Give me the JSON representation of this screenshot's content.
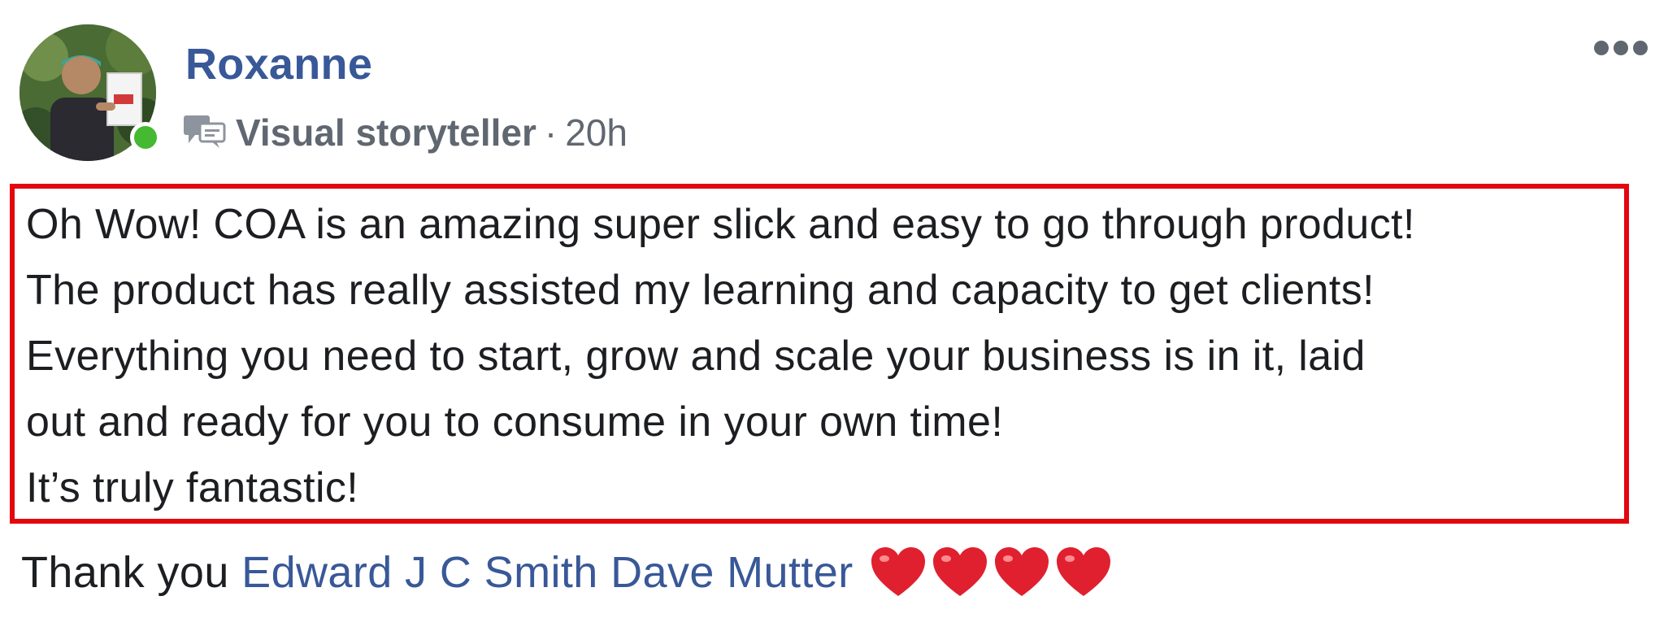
{
  "post": {
    "author": "Roxanne",
    "badge": "Visual storyteller",
    "separator": "·",
    "timestamp": "20h",
    "body_lines": [
      "Oh Wow! COA is an amazing super slick and easy to go through product!",
      "The product has really assisted my learning and capacity to get clients!",
      "Everything you need to start, grow and scale your business is in it, laid",
      "out and ready for you to consume in your own time!",
      "It’s truly fantastic!"
    ],
    "thanks_text": "Thank you ",
    "mentions": [
      "Edward J C Smith",
      "Dave Mutter"
    ],
    "heart_count": 4
  },
  "icons": {
    "badge_icon": "speech-bubble-icon",
    "more_icon": "more-options-icon",
    "heart_icon": "red-heart-icon",
    "online_indicator": "online-status-dot"
  },
  "colors": {
    "author_link": "#385898",
    "meta_text": "#606770",
    "body_text": "#1c1e21",
    "highlight_box": "#e3060f",
    "online": "#44b931",
    "heart": "#e0202e"
  }
}
